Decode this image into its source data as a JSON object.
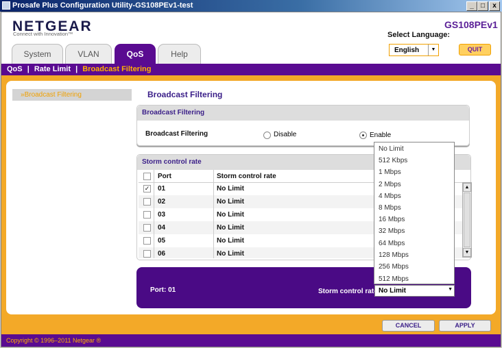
{
  "window": {
    "title": "Prosafe Plus Configuration Utility-GS108PEv1-test",
    "minimize": "_",
    "maximize": "□",
    "close": "x"
  },
  "header": {
    "logo": "NETGEAR",
    "tagline": "Connect with Innovation™",
    "model": "GS108PEv1",
    "language_label": "Select Language:",
    "language_value": "English",
    "quit_label": "QUIT"
  },
  "tabs": [
    {
      "label": "System"
    },
    {
      "label": "VLAN"
    },
    {
      "label": "QoS",
      "active": true
    },
    {
      "label": "Help"
    }
  ],
  "submenu": {
    "items": [
      "QoS",
      "Rate Limit",
      "Broadcast Filtering"
    ],
    "separator": "|",
    "current": "Broadcast Filtering"
  },
  "leftnav": {
    "item": "Broadcast Filtering"
  },
  "page": {
    "title": "Broadcast Filtering"
  },
  "broadcast_box": {
    "header": "Broadcast Filtering",
    "label": "Broadcast Filtering",
    "options": [
      "Disable",
      "Enable"
    ],
    "selected": "Enable"
  },
  "storm_box": {
    "header": "Storm control rate",
    "columns": [
      "Port",
      "Storm control rate"
    ],
    "rows": [
      {
        "port": "01",
        "rate": "No Limit",
        "checked": true
      },
      {
        "port": "02",
        "rate": "No Limit",
        "checked": false
      },
      {
        "port": "03",
        "rate": "No Limit",
        "checked": false
      },
      {
        "port": "04",
        "rate": "No Limit",
        "checked": false
      },
      {
        "port": "05",
        "rate": "No Limit",
        "checked": false
      },
      {
        "port": "06",
        "rate": "No Limit",
        "checked": false
      }
    ]
  },
  "edit_panel": {
    "port_label": "Port: 01",
    "rate_label": "Storm control rate",
    "rate_value": "No Limit"
  },
  "dropdown_options": [
    "No Limit",
    "512 Kbps",
    "1 Mbps",
    "2 Mbps",
    "4 Mbps",
    "8 Mbps",
    "16 Mbps",
    "32 Mbps",
    "64 Mbps",
    "128 Mbps",
    "256 Mbps",
    "512 Mbps"
  ],
  "buttons": {
    "cancel": "CANCEL",
    "apply": "APPLY"
  },
  "footer": {
    "copyright": "Copyright © 1996–2011 Netgear ®"
  },
  "colors": {
    "brand_purple": "#5a0b91",
    "accent_orange": "#f3a928",
    "highlight_orange": "#ffb000"
  }
}
